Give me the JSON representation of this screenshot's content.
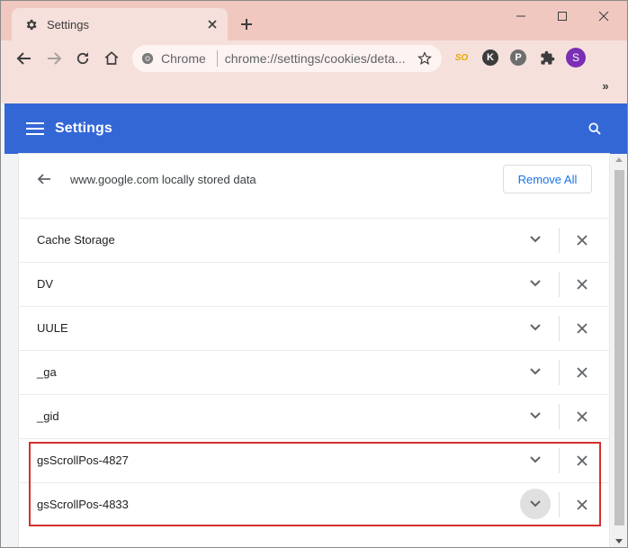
{
  "tab": {
    "title": "Settings",
    "icon": "gear-icon"
  },
  "window_controls": {
    "minimize": "minimize-icon",
    "maximize": "maximize-icon",
    "close": "close-icon"
  },
  "omnibox": {
    "chip_label": "Chrome",
    "url": "chrome://settings/cookies/deta..."
  },
  "extensions": [
    {
      "name": "so-extension-icon",
      "glyph": "SO",
      "color": "#e6a800"
    },
    {
      "name": "k-extension-icon",
      "glyph": "K"
    },
    {
      "name": "pinterest-extension-icon",
      "glyph": "P"
    },
    {
      "name": "puzzle-extensions-icon"
    }
  ],
  "profile": {
    "initial": "S",
    "color": "#7b2eb6"
  },
  "more_extensions": "»",
  "header": {
    "title": "Settings",
    "color": "#3367d6"
  },
  "subpage": {
    "title": "www.google.com locally stored data",
    "remove_all_label": "Remove All"
  },
  "items": [
    {
      "label": "Cache Storage"
    },
    {
      "label": "DV"
    },
    {
      "label": "UULE"
    },
    {
      "label": "_ga"
    },
    {
      "label": "_gid"
    },
    {
      "label": "gsScrollPos-4827"
    },
    {
      "label": "gsScrollPos-4833"
    }
  ],
  "highlight_color": "#d32f2f"
}
